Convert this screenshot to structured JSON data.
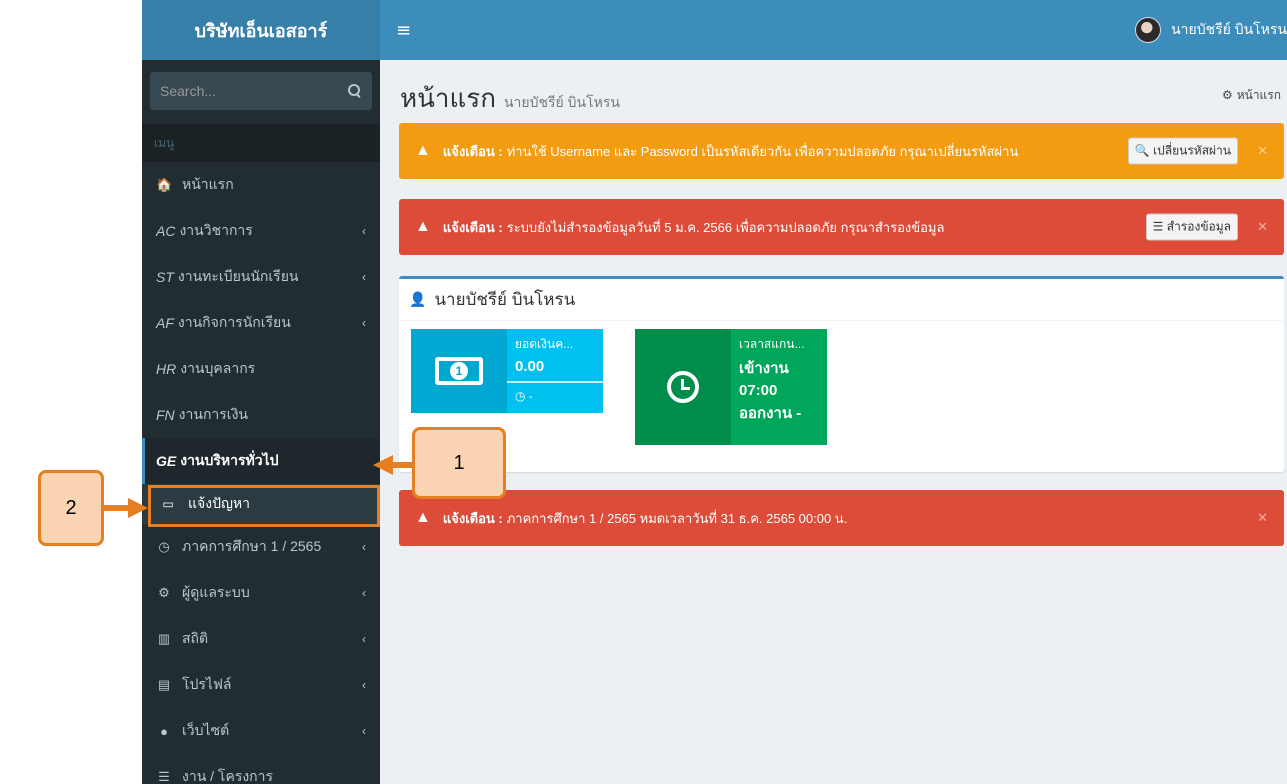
{
  "sidebar": {
    "brand": "บริษัทเอ็นเอสอาร์",
    "search_placeholder": "Search...",
    "menu_header": "เมนู",
    "items": [
      {
        "icon": "home-icon",
        "glyph": "🏠",
        "prefix": "",
        "label": "หน้าแรก",
        "chevron": ""
      },
      {
        "icon": "",
        "glyph": "",
        "prefix": "AC",
        "label": "งานวิชาการ",
        "chevron": "‹"
      },
      {
        "icon": "",
        "glyph": "",
        "prefix": "ST",
        "label": "งานทะเบียนนักเรียน",
        "chevron": "‹"
      },
      {
        "icon": "",
        "glyph": "",
        "prefix": "AF",
        "label": "งานกิจการนักเรียน",
        "chevron": "‹"
      },
      {
        "icon": "",
        "glyph": "",
        "prefix": "HR",
        "label": "งานบุคลากร",
        "chevron": ""
      },
      {
        "icon": "",
        "glyph": "",
        "prefix": "FN",
        "label": "งานการเงิน",
        "chevron": ""
      },
      {
        "icon": "",
        "glyph": "",
        "prefix": "GE",
        "label": "งานบริหารทั่วไป",
        "chevron": ""
      }
    ],
    "sub_item": {
      "icon": "inbox-icon",
      "glyph": "▭",
      "label": "แจ้งปัญหา"
    },
    "items_after": [
      {
        "icon": "clock-icon",
        "glyph": "◷",
        "label": "ภาคการศึกษา 1 / 2565",
        "chevron": "‹"
      },
      {
        "icon": "gears-icon",
        "glyph": "⚙",
        "label": "ผู้ดูแลระบบ",
        "chevron": "‹"
      },
      {
        "icon": "bar-chart-icon",
        "glyph": "▥",
        "label": "สถิติ",
        "chevron": "‹"
      },
      {
        "icon": "file-icon",
        "glyph": "▤",
        "label": "โปรไฟล์",
        "chevron": "‹"
      },
      {
        "icon": "globe-icon",
        "glyph": "●",
        "label": "เว็บไซต์",
        "chevron": "‹"
      },
      {
        "icon": "list-icon",
        "glyph": "☰",
        "label": "งาน / โครงการ",
        "chevron": ""
      }
    ]
  },
  "navbar": {
    "menu_glyph": "≡",
    "user_name": "นายบัชรีย์ บินโหรน"
  },
  "page": {
    "title": "หน้าแรก",
    "subtitle": "นายบัชรีย์ บินโหรน",
    "breadcrumb": "หน้าแรก"
  },
  "alerts": [
    {
      "type": "warning",
      "title": "แจ้งเตือน :",
      "text": "ท่านใช้ Username และ Password เป็นรหัสเดียวกัน เพื่อความปลอดภัย กรุณาเปลี่ยนรหัสผ่าน",
      "button": "🔍 เปลี่ยนรหัสผ่าน"
    },
    {
      "type": "danger",
      "title": "แจ้งเตือน :",
      "text": "ระบบยังไม่สำรองข้อมูลวันที่ 5 ม.ค. 2566 เพื่อความปลอดภัย กรุณาสำรองข้อมูล",
      "button": "☰ สำรองข้อมูล"
    },
    {
      "type": "danger",
      "title": "แจ้งเตือน :",
      "text": "ภาคการศึกษา 1 / 2565 หมดเวลาวันที่ 31 ธ.ค. 2565 00:00 น.",
      "button": ""
    }
  ],
  "user_box": {
    "title": "นายบัชรีย์ บินโหรน",
    "money": {
      "label": "ยอดเงินค...",
      "value": "0.00",
      "footer": "◷ -"
    },
    "time": {
      "label": "เวลาสแกน...",
      "in": "เข้างาน",
      "in_time": "07:00",
      "out": "ออกงาน -"
    }
  },
  "annotations": {
    "callout_1": "1",
    "callout_2": "2"
  },
  "colors": {
    "sidebar_bg": "#222d32",
    "brand_bg": "#367fa9",
    "navbar_bg": "#3c8dbc",
    "warning": "#f39c12",
    "danger": "#dd4b39",
    "aqua": "#00c0ef",
    "green": "#00a65a",
    "annotation": "#e67e22"
  }
}
